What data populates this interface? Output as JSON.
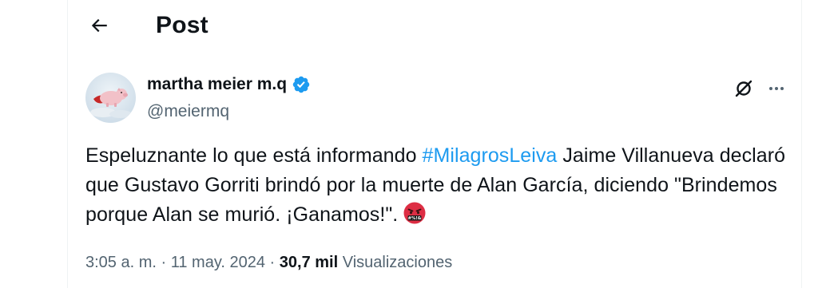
{
  "header": {
    "title": "Post",
    "back_icon": "arrow-left-icon"
  },
  "author": {
    "name": "martha meier m.q",
    "handle": "@meiermq",
    "verified": true,
    "verified_color": "#1d9bf0"
  },
  "actions": {
    "grok_icon": "grok-icon",
    "more_icon": "more-horizontal-icon"
  },
  "tweet": {
    "text_before": "Espeluznante lo que está informando ",
    "hashtag": "#MilagrosLeiva",
    "text_after": " Jaime Villanueva declaró que Gustavo Gorriti brindó por la muerte de Alan García, diciendo \"Brindemos porque Alan se murió. ¡Ganamos!\".",
    "emoji": "face-with-symbols-on-mouth-emoji",
    "hashtag_color": "#1d9bf0"
  },
  "meta": {
    "time": "3:05 a. m.",
    "separator": "·",
    "date": "11 may. 2024",
    "views_count": "30,7 mil",
    "views_label": "Visualizaciones"
  }
}
